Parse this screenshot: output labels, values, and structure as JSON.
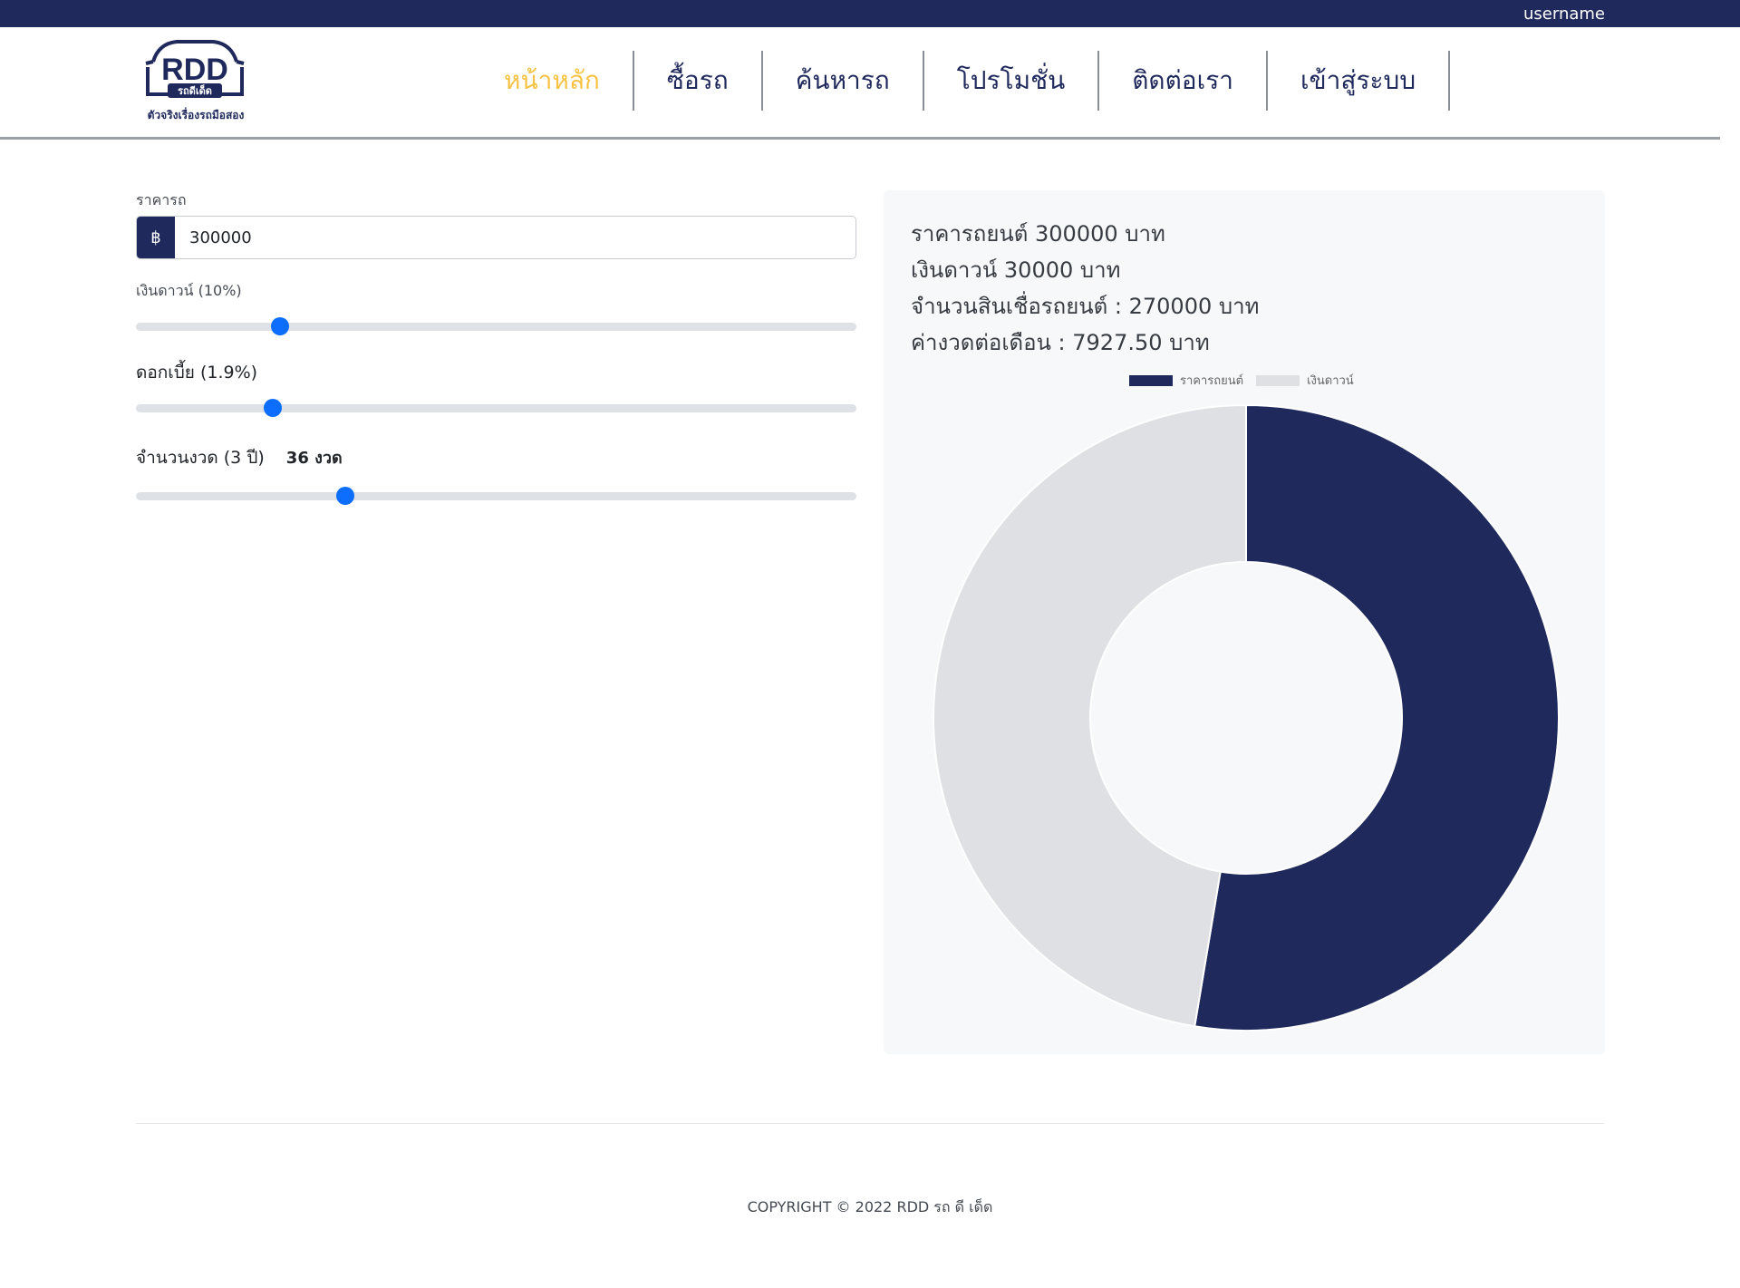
{
  "topbar": {
    "username": "username"
  },
  "logo": {
    "brand": "RDD",
    "badge": "รถดีเด็ด",
    "tagline": "ตัวจริงเรื่องรถมือสอง"
  },
  "nav": {
    "items": [
      {
        "label": "หน้าหลัก",
        "active": true
      },
      {
        "label": "ซื้อรถ",
        "active": false
      },
      {
        "label": "ค้นหารถ",
        "active": false
      },
      {
        "label": "โปรโมชั่น",
        "active": false
      },
      {
        "label": "ติดต่อเรา",
        "active": false
      },
      {
        "label": "เข้าสู่ระบบ",
        "active": false
      }
    ]
  },
  "form": {
    "price_label": "ราคารถ",
    "currency_symbol": "฿",
    "price_value": "300000",
    "down_label": "เงินดาวน์ (10%)",
    "down_fraction": 0.2,
    "interest_label": "ดอกเบี้ย (1.9%)",
    "interest_fraction": 0.19,
    "term_label": "จำนวนงวด (3 ปี)",
    "term_count": "36 งวด",
    "term_fraction": 0.29
  },
  "summary": {
    "car_price": "ราคารถยนต์ 300000 บาท",
    "down_payment": "เงินดาวน์ 30000 บาท",
    "loan_amount": "จำนวนสินเชื่อรถยนต์ : 270000 บาท",
    "monthly": "ค่างวดต่อเดือน : 7927.50 บาท"
  },
  "chart_data": {
    "type": "pie",
    "style": "doughnut",
    "labels": [
      "ราคารถยนต์",
      "เงินดาวน์"
    ],
    "values": [
      300000,
      270000
    ],
    "colors": [
      "#1f295c",
      "#dee0e3"
    ],
    "legend": "top"
  },
  "footer": {
    "copyright": "COPYRIGHT © 2022 RDD รถ ดี เด็ด"
  },
  "colors": {
    "brand": "#1f295c",
    "accent": "#f5c242",
    "slider": "#0d6efd"
  }
}
